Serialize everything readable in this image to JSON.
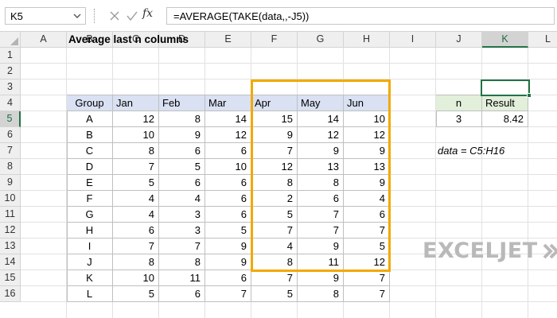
{
  "formula_bar": {
    "name_box": "K5",
    "formula": "=AVERAGE(TAKE(data,,-J5))",
    "icons": [
      "chevron-down-icon",
      "cancel-icon",
      "enter-icon",
      "function-icon"
    ],
    "fx_label": "fx"
  },
  "columns": [
    "A",
    "B",
    "C",
    "D",
    "E",
    "F",
    "G",
    "H",
    "I",
    "J",
    "K",
    "L"
  ],
  "rows": [
    "1",
    "2",
    "3",
    "4",
    "5",
    "6",
    "7",
    "8",
    "9",
    "10",
    "11",
    "12",
    "13",
    "14",
    "15",
    "16"
  ],
  "active_cell": {
    "column": "K",
    "row": "5"
  },
  "sheet": {
    "title": "Average last n columns",
    "table": {
      "headers": [
        "Group",
        "Jan",
        "Feb",
        "Mar",
        "Apr",
        "May",
        "Jun"
      ],
      "rows": [
        [
          "A",
          12,
          8,
          14,
          15,
          14,
          10
        ],
        [
          "B",
          10,
          9,
          12,
          9,
          12,
          12
        ],
        [
          "C",
          8,
          6,
          6,
          7,
          9,
          9
        ],
        [
          "D",
          7,
          5,
          10,
          12,
          13,
          13
        ],
        [
          "E",
          5,
          6,
          6,
          8,
          8,
          9
        ],
        [
          "F",
          4,
          4,
          6,
          2,
          6,
          4
        ],
        [
          "G",
          4,
          3,
          6,
          5,
          7,
          6
        ],
        [
          "H",
          6,
          3,
          5,
          7,
          7,
          7
        ],
        [
          "I",
          7,
          7,
          9,
          4,
          9,
          5
        ],
        [
          "J",
          8,
          8,
          9,
          8,
          11,
          12
        ],
        [
          "K",
          10,
          11,
          6,
          7,
          9,
          7
        ],
        [
          "L",
          5,
          6,
          7,
          5,
          8,
          7
        ]
      ]
    },
    "input": {
      "n_label": "n",
      "result_label": "Result",
      "n_value": "3",
      "result_value": "8.42"
    },
    "note": "data = C5:H16"
  },
  "colors": {
    "header_fill": "#d9e1f2",
    "input_header_fill": "#e2efda",
    "highlight": "#f2a900",
    "selection": "#217346"
  },
  "logo": {
    "text": "EXCELJET",
    "icon": "exceljet-logo-icon"
  }
}
